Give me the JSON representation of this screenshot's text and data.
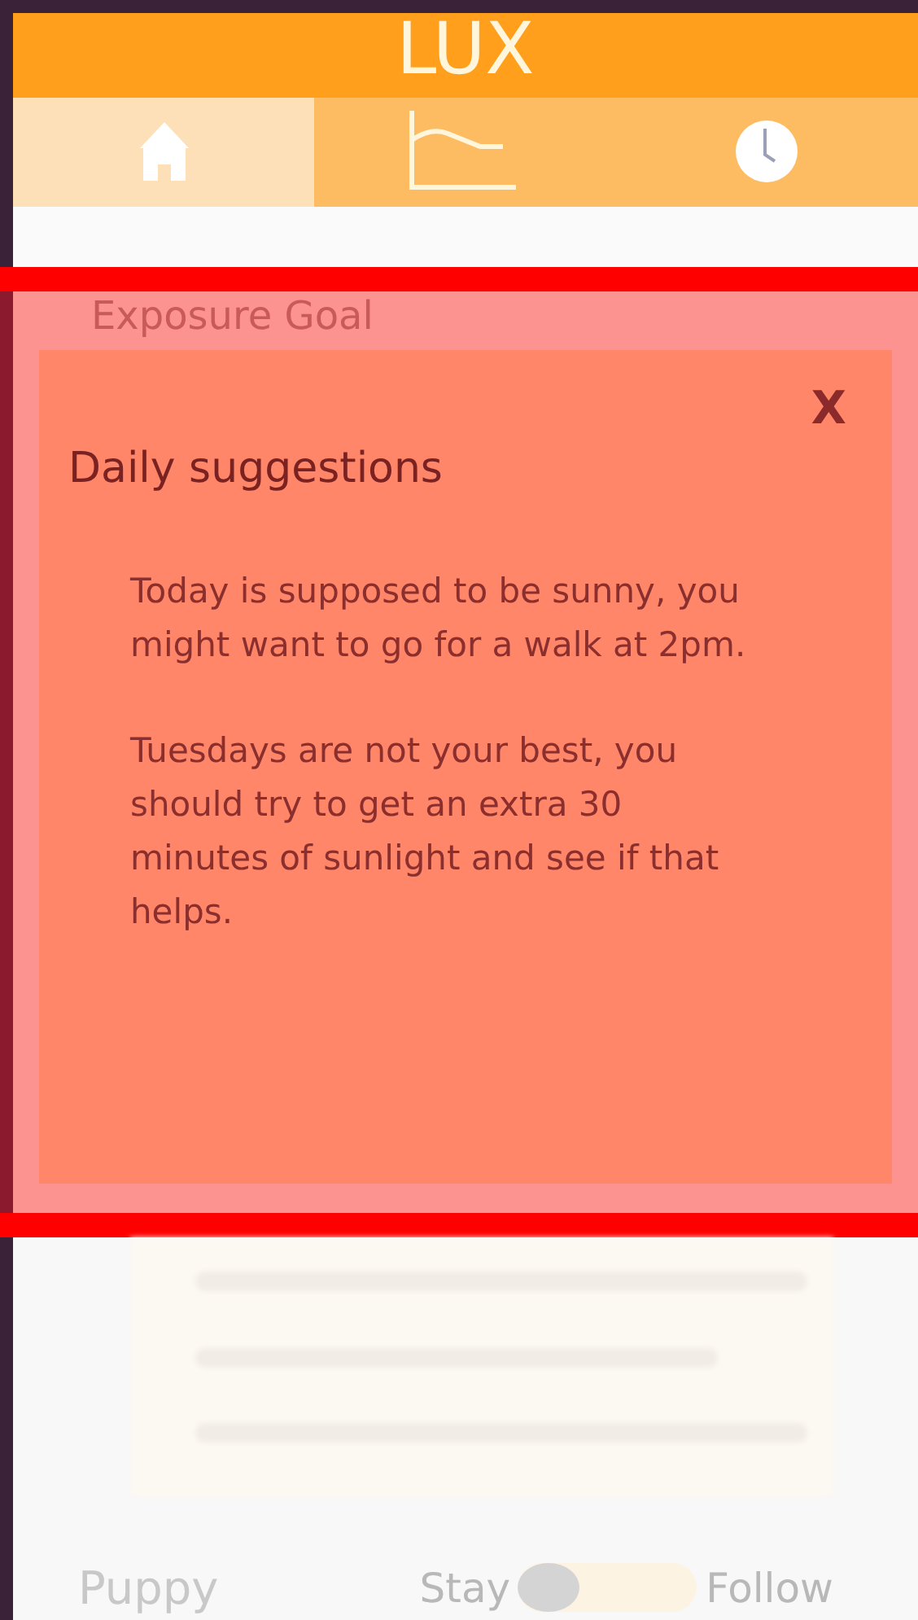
{
  "header": {
    "title": "LUX"
  },
  "tabs": [
    {
      "kind": "home",
      "selected": true
    },
    {
      "kind": "chart",
      "selected": false
    },
    {
      "kind": "clock",
      "selected": false
    }
  ],
  "section": {
    "title": "Exposure Goal"
  },
  "dialog": {
    "title": "Daily suggestions",
    "close": "X",
    "paragraphs": [
      "Today is supposed to be sunny, you might want to go for a walk at 2pm.",
      "Tuesdays are not your best, you should try to get an extra 30 minutes of sunlight and see if that helps."
    ]
  },
  "pet": {
    "name": "Puppy",
    "left_label": "Stay",
    "right_label": "Follow",
    "on": false
  }
}
